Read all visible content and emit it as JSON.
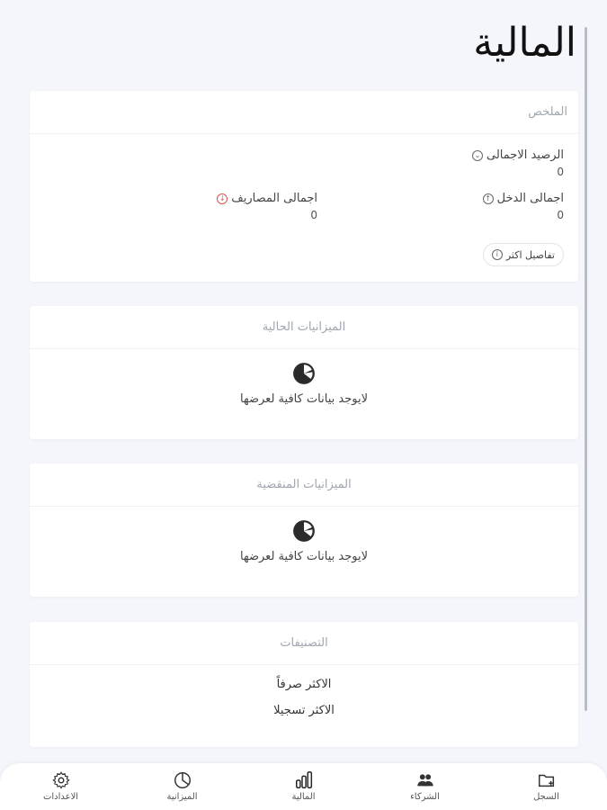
{
  "page": {
    "title": "المالية"
  },
  "summary": {
    "header": "الملخص",
    "total_balance_label": "الرصيد الاجمالى",
    "total_balance_value": "0",
    "total_income_label": "اجمالى الدخل",
    "total_income_value": "0",
    "total_expenses_label": "اجمالى المصاريف",
    "total_expenses_value": "0",
    "details_button": "تفاصيل اكثر"
  },
  "current_budgets": {
    "header": "الميزانيات الحالية",
    "empty_text": "لايوجد بيانات كافية لعرضها"
  },
  "expired_budgets": {
    "header": "الميزانيات المنقضية",
    "empty_text": "لايوجد بيانات كافية لعرضها"
  },
  "categories": {
    "header": "التصنيفات",
    "items": [
      "الاكثر صرفاً",
      "الاكثر تسجيلا"
    ]
  },
  "bottom_nav": {
    "items": [
      {
        "label": "السجل",
        "icon": "folder-add-icon"
      },
      {
        "label": "الشركاء",
        "icon": "partners-icon"
      },
      {
        "label": "المالية",
        "icon": "finance-bars-icon"
      },
      {
        "label": "الميزانية",
        "icon": "pie-chart-icon"
      },
      {
        "label": "الاعدادات",
        "icon": "gear-icon"
      }
    ]
  },
  "colors": {
    "background": "#f4f6fb",
    "card": "#ffffff",
    "expense_accent": "#d9534f",
    "muted_text": "#a0a6b1"
  }
}
